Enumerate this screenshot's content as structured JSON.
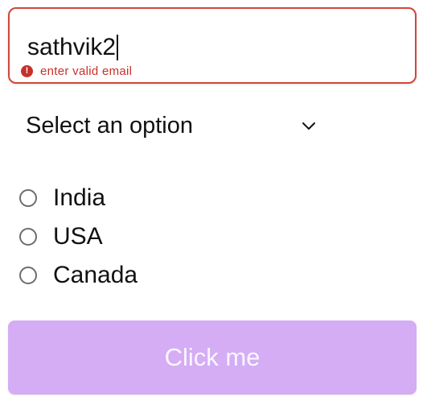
{
  "email": {
    "value": "sathvik2",
    "error_text": "enter valid email",
    "error_icon": "!",
    "border_color": "#d0473d",
    "error_color": "#c7302b"
  },
  "select": {
    "selected_label": "Select an option",
    "icon": "chevron-down-icon"
  },
  "radio": {
    "options": [
      {
        "label": "India",
        "checked": false
      },
      {
        "label": "USA",
        "checked": false
      },
      {
        "label": "Canada",
        "checked": false
      }
    ]
  },
  "button": {
    "label": "Click me",
    "background": "#d4adf5"
  }
}
